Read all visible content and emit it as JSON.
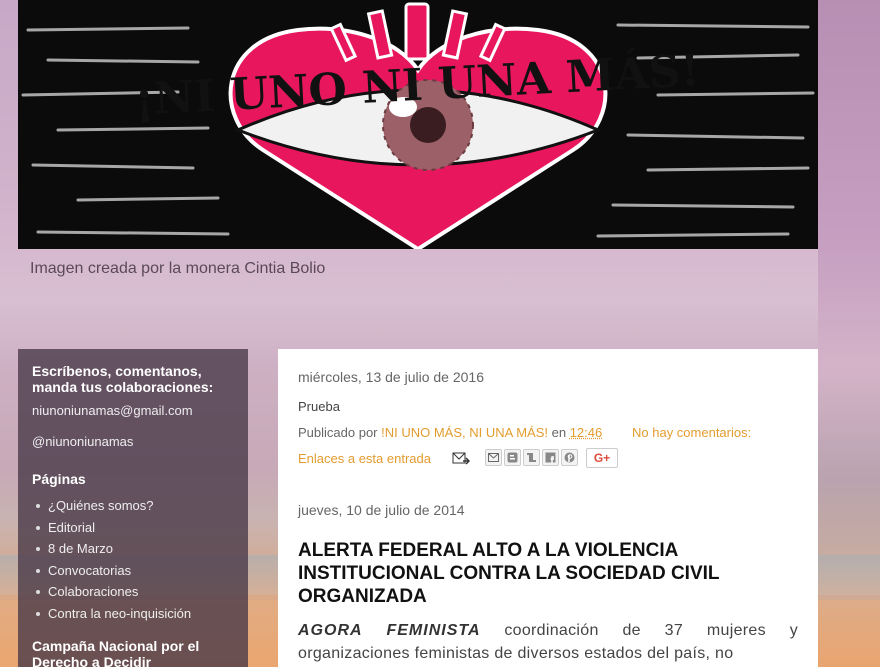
{
  "banner": {
    "title_art": "¡NI UNO NI UNA MÁS!",
    "caption": "Imagen creada por la monera Cintia Bolio"
  },
  "sidebar": {
    "contact_title": "Escríbenos, comentanos, manda tus colaboraciones:",
    "email": "niunoniunamas@gmail.com",
    "handle": "@niunoniunamas",
    "pages_title": "Páginas",
    "pages": [
      "¿Quiénes somos?",
      "Editorial",
      "8 de Marzo",
      "Convocatorias",
      "Colaboraciones",
      "Contra la neo-inquisición"
    ],
    "campaign_title": "Campaña Nacional por el Derecho a Decidir"
  },
  "posts": [
    {
      "date": "miércoles, 13 de julio de 2016",
      "body": "Prueba",
      "published_by_prefix": "Publicado por",
      "author": "!NI UNO MÁS, NI UNA MÁS!",
      "in_word": "en",
      "time": "12:46",
      "comments": "No hay comentarios:",
      "backlinks": "Enlaces a esta entrada",
      "share_icons": [
        "email-icon",
        "blogger-icon",
        "twitter-icon",
        "facebook-icon",
        "pinterest-icon"
      ],
      "gplus": "G+"
    },
    {
      "date": "jueves, 10 de julio de 2014",
      "title": "ALERTA FEDERAL ALTO A LA VIOLENCIA INSTITUCIONAL CONTRA LA SOCIEDAD CIVIL ORGANIZADA",
      "excerpt_lead": "AGORA FEMINISTA",
      "excerpt_rest": " coordinación de 37 mujeres y organizaciones feministas de diversos estados del país, no"
    }
  ],
  "colors": {
    "link": "#e39c2f",
    "heart": "#e8175d",
    "sidebar_bg": "#46374680"
  }
}
